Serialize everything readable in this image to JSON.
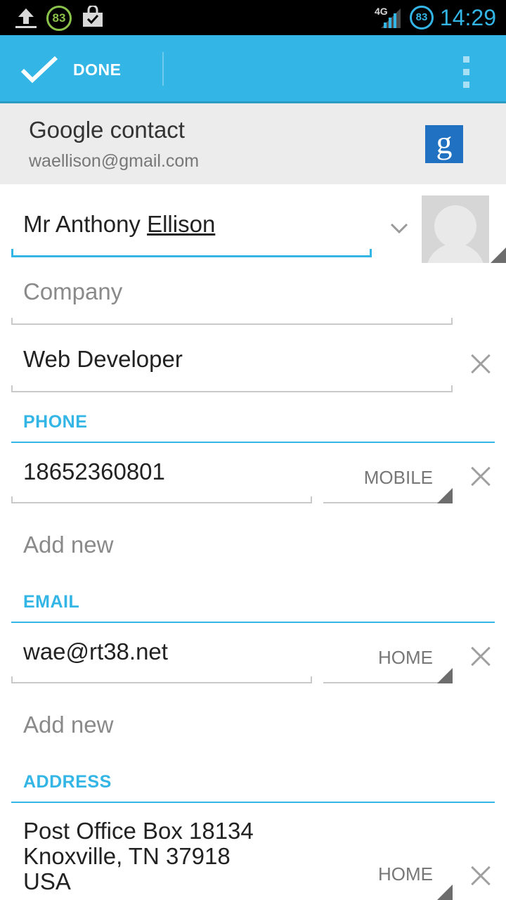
{
  "status_bar": {
    "network": "4G",
    "battery_badge": "83",
    "battery_right": "83",
    "time": "14:29",
    "icons": [
      "upload-icon",
      "battery-circle-icon",
      "shopping-bag-icon",
      "signal-icon"
    ]
  },
  "action_bar": {
    "done_label": "DONE",
    "icons": [
      "checkmark-icon",
      "overflow-menu-icon"
    ],
    "color": "#33b5e5"
  },
  "account": {
    "type_label": "Google contact",
    "email": "waellison@gmail.com",
    "logo_letter": "g"
  },
  "name": {
    "value_plain": "Mr Anthony ",
    "value_underlined": "Ellison"
  },
  "company": {
    "placeholder": "Company"
  },
  "title": {
    "value": "Web Developer"
  },
  "phone": {
    "header": "PHONE",
    "value": "18652360801",
    "type": "MOBILE",
    "add_new": "Add new"
  },
  "email": {
    "header": "EMAIL",
    "value": "wae@rt38.net",
    "type": "HOME",
    "add_new": "Add new"
  },
  "address": {
    "header": "ADDRESS",
    "line1": "Post Office Box 18134",
    "line2": "Knoxville, TN 37918",
    "line3": "USA",
    "type": "HOME"
  }
}
